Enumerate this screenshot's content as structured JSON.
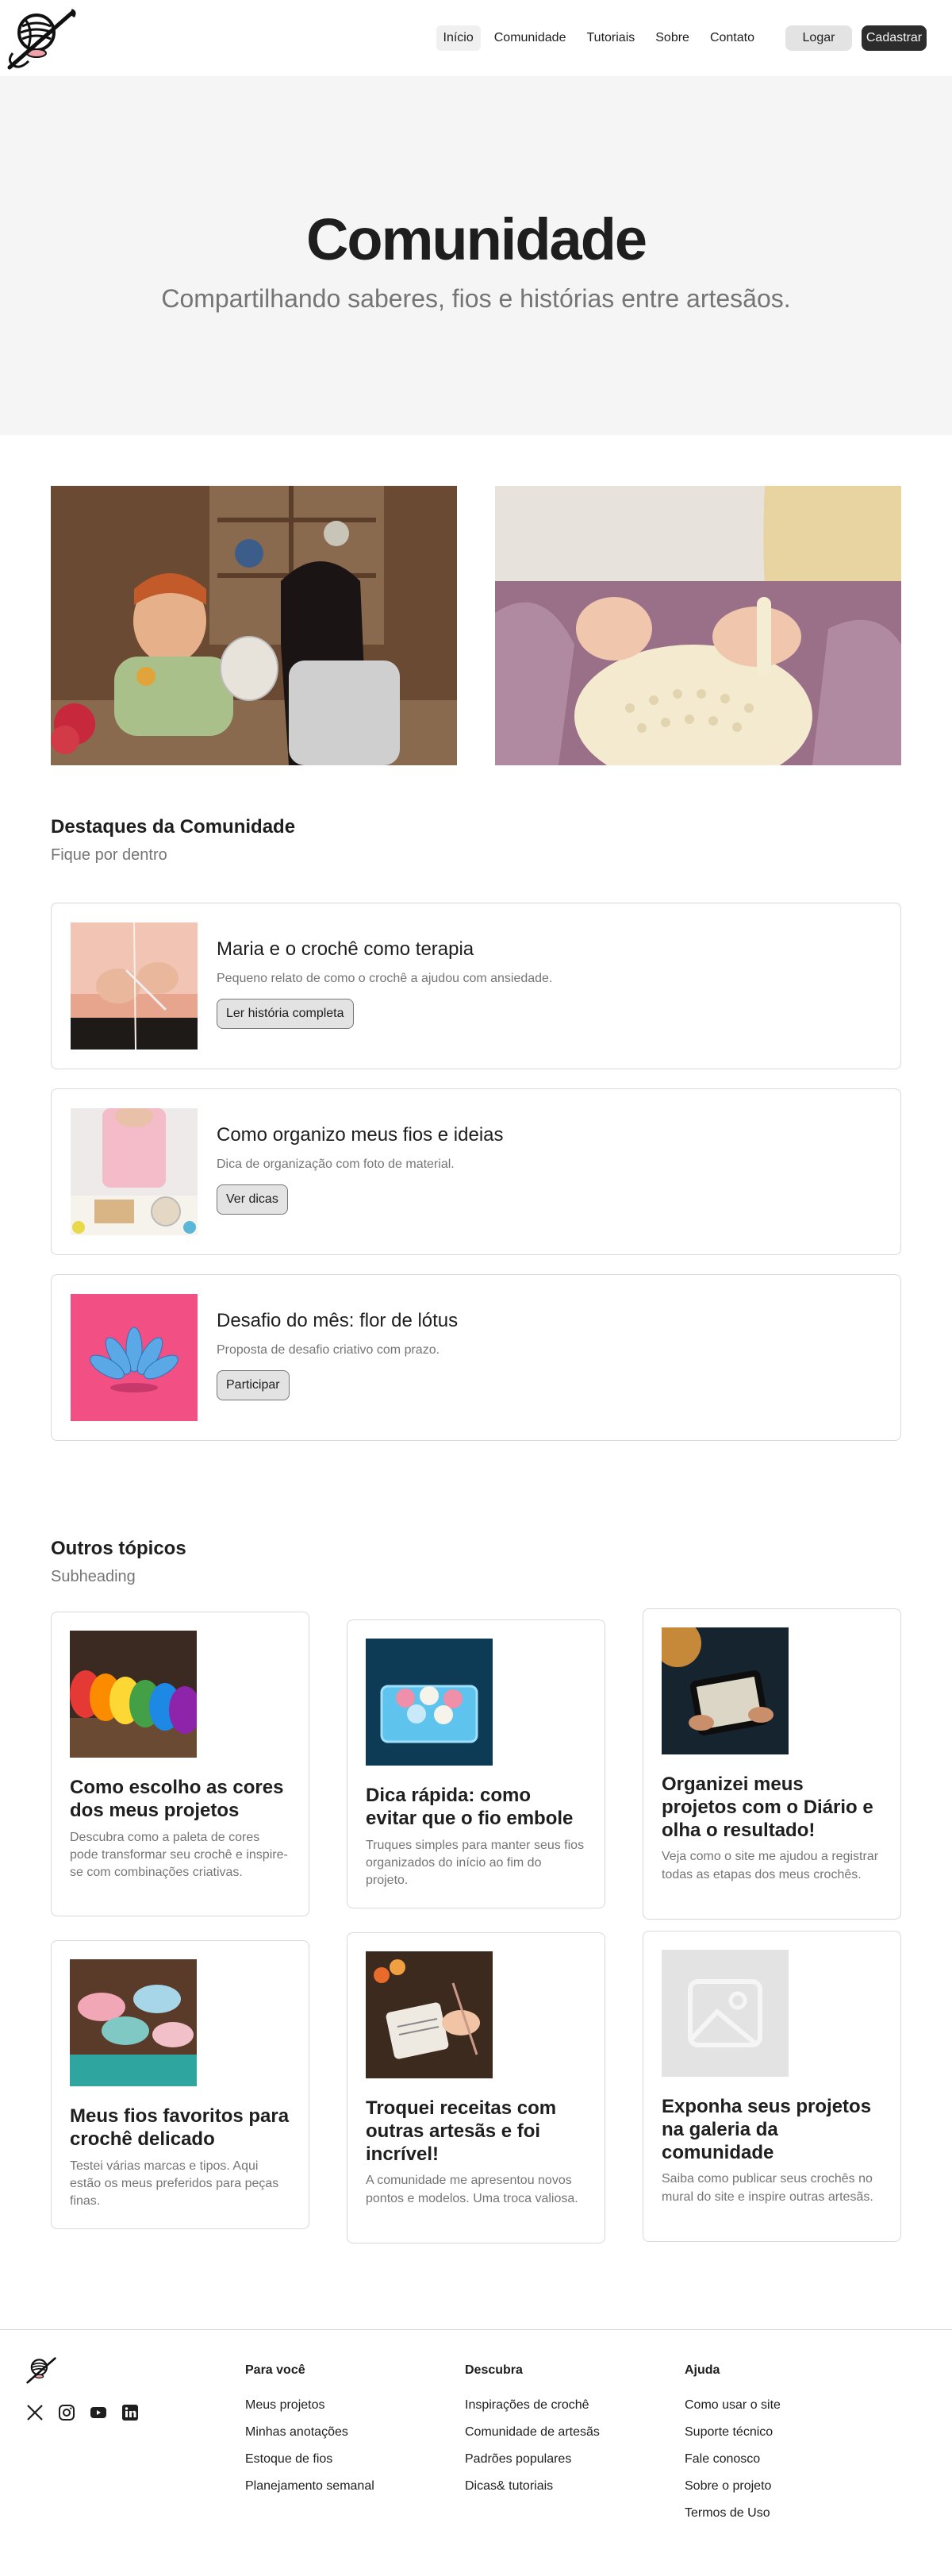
{
  "header": {
    "nav": [
      "Início",
      "Comunidade",
      "Tutoriais",
      "Sobre",
      "Contato"
    ],
    "login": "Logar",
    "signup": "Cadastrar"
  },
  "hero": {
    "title": "Comunidade",
    "subtitle": "Compartilhando saberes, fios e histórias entre artesãos."
  },
  "highlights": {
    "title": "Destaques da Comunidade",
    "subtitle": "Fique por dentro",
    "items": [
      {
        "title": "Maria e o crochê como terapia",
        "desc": "Pequeno relato de como o crochê a ajudou com ansiedade.",
        "button": "Ler história completa"
      },
      {
        "title": "Como organizo meus fios e ideias",
        "desc": "Dica de organização com foto de material.",
        "button": "Ver dicas"
      },
      {
        "title": "Desafio do mês: flor de lótus",
        "desc": "Proposta de desafio criativo com prazo.",
        "button": "Participar"
      }
    ]
  },
  "topics": {
    "title": "Outros tópicos",
    "subtitle": "Subheading",
    "items": [
      {
        "title": "Como escolho as cores dos meus projetos",
        "desc": "Descubra como a paleta de cores pode transformar seu crochê e inspire-se com combinações criativas."
      },
      {
        "title": "Dica rápida: como evitar que o fio embole",
        "desc": "Truques simples para manter seus fios organizados do início ao fim do projeto."
      },
      {
        "title": "Organizei meus projetos com o Diário e olha o resultado!",
        "desc": "Veja como o site me ajudou a registrar todas as etapas dos meus crochês."
      },
      {
        "title": "Meus fios favoritos para crochê delicado",
        "desc": "Testei várias marcas e tipos. Aqui estão os meus preferidos para peças finas."
      },
      {
        "title": "Troquei receitas com outras artesãs e foi incrível!",
        "desc": " A comunidade me apresentou novos pontos e modelos. Uma troca valiosa."
      },
      {
        "title": "Exponha seus projetos na galeria da comunidade",
        "desc": "Saiba como publicar seus crochês no mural do site e inspire outras artesãs."
      }
    ]
  },
  "footer": {
    "columns": [
      {
        "title": "Para você",
        "links": [
          "Meus projetos",
          "Minhas anotações",
          "Estoque de fios",
          "Planejamento semanal"
        ]
      },
      {
        "title": "Descubra",
        "links": [
          "Inspirações de crochê",
          "Comunidade de artesãs",
          "Padrões populares",
          "Dicas& tutoriais"
        ]
      },
      {
        "title": "Ajuda",
        "links": [
          "Como usar o site",
          "Suporte técnico",
          "Fale conosco",
          "Sobre o projeto",
          "Termos de Uso"
        ]
      }
    ],
    "socials": [
      "x-icon",
      "instagram-icon",
      "youtube-icon",
      "linkedin-icon"
    ]
  }
}
